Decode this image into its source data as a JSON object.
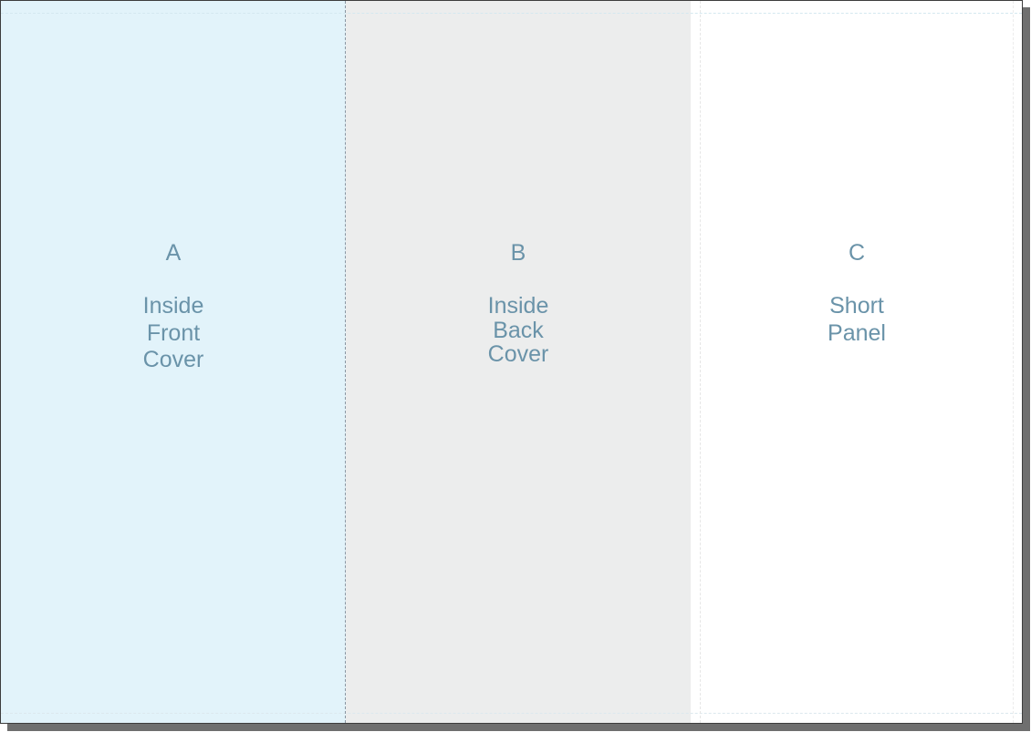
{
  "panels": [
    {
      "letter": "A",
      "label_lines": [
        "Inside",
        "Front",
        "Cover"
      ],
      "background": "#e2f3fa"
    },
    {
      "letter": "B",
      "label_lines": [
        "Inside",
        "Back",
        "Cover"
      ],
      "background": "#eceded"
    },
    {
      "letter": "C",
      "label_lines": [
        "Short",
        "Panel"
      ],
      "background": "#ffffff"
    }
  ],
  "colors": {
    "text": "#6a93a9",
    "shadow": "#6f6f6f",
    "border": "#3d3d3d",
    "fold_line": "#8a96a2"
  }
}
